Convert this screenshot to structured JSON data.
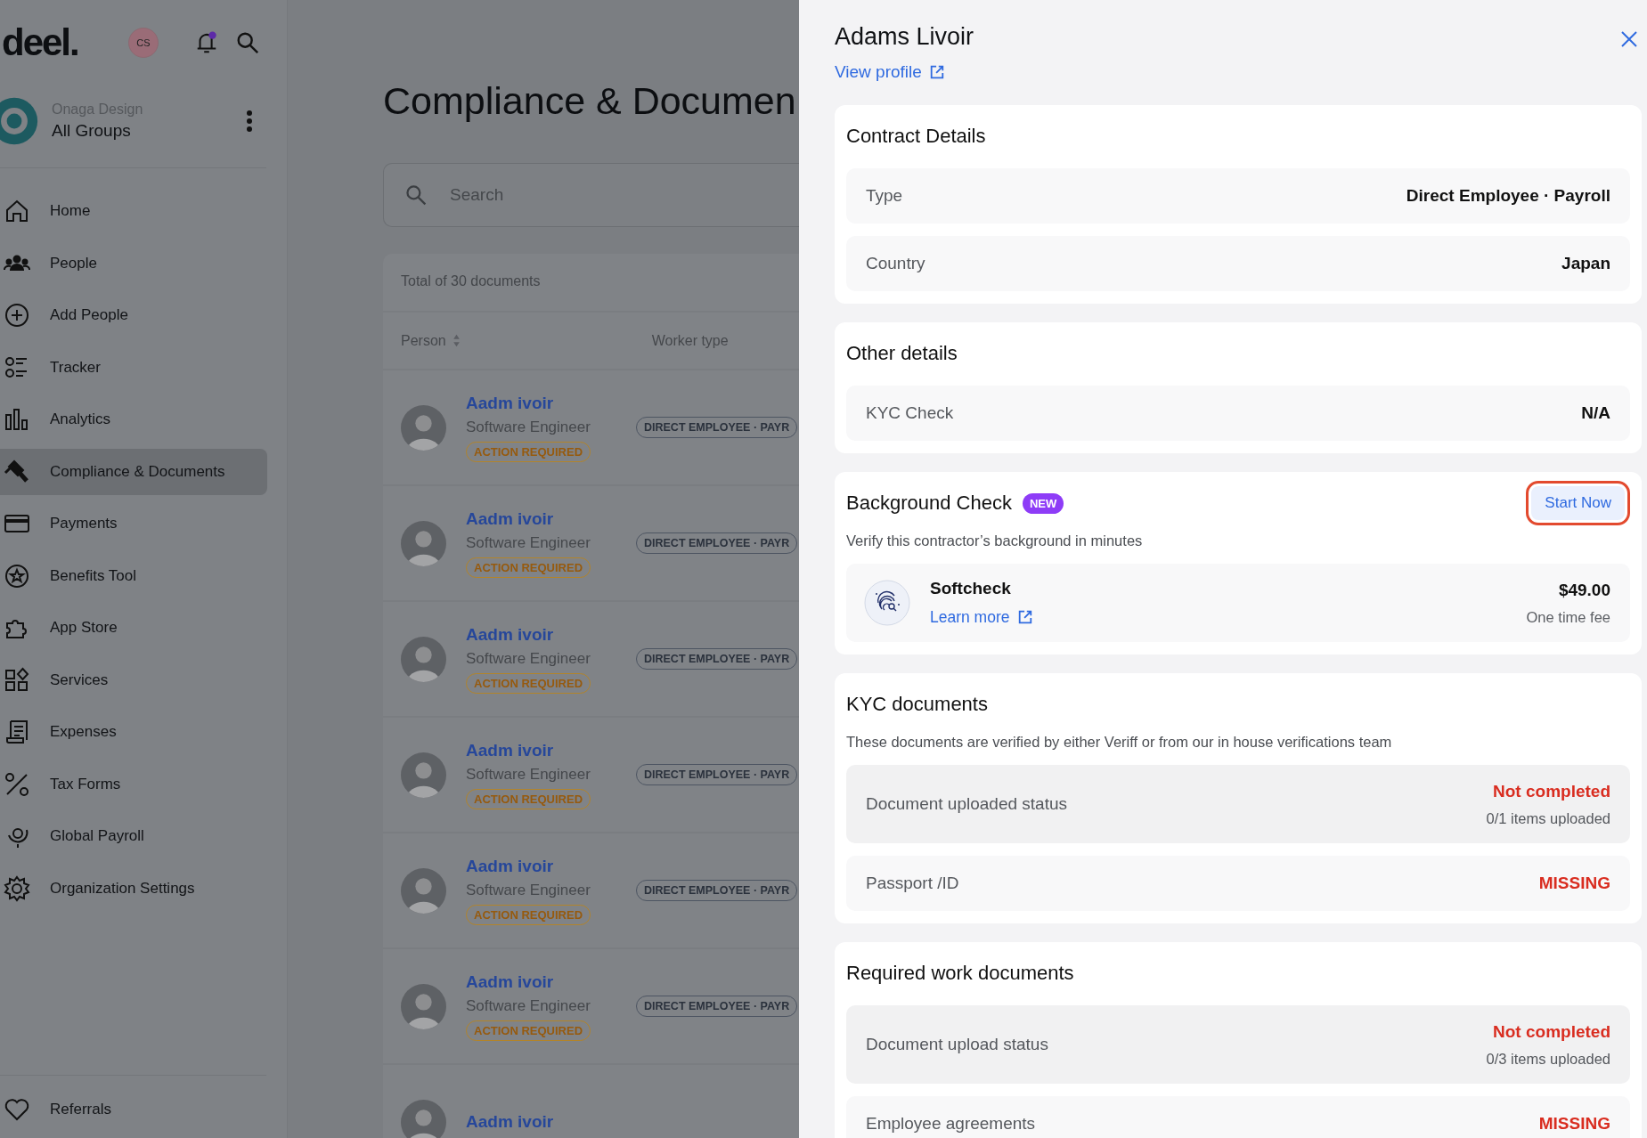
{
  "sidebar": {
    "logo": "deel.",
    "user_initials": "CS",
    "notification_unread": true,
    "org_name": "Onaga Design",
    "group": "All Groups",
    "items": [
      {
        "label": "Home",
        "selected": false
      },
      {
        "label": "People",
        "selected": false
      },
      {
        "label": "Add People",
        "selected": false
      },
      {
        "label": "Tracker",
        "selected": false
      },
      {
        "label": "Analytics",
        "selected": false
      },
      {
        "label": "Compliance & Documents",
        "selected": true
      },
      {
        "label": "Payments",
        "selected": false
      },
      {
        "label": "Benefits Tool",
        "selected": false
      },
      {
        "label": "App Store",
        "selected": false
      },
      {
        "label": "Services",
        "selected": false
      },
      {
        "label": "Expenses",
        "selected": false
      },
      {
        "label": "Tax Forms",
        "selected": false
      },
      {
        "label": "Global Payroll",
        "selected": false
      },
      {
        "label": "Organization Settings",
        "selected": false
      }
    ],
    "footer_items": [
      {
        "label": "Referrals",
        "selected": false
      }
    ]
  },
  "main": {
    "title": "Compliance & Documen",
    "search": {
      "placeholder": "Search"
    },
    "total": "Total of 30 documents",
    "columns": [
      "Person",
      "Worker type"
    ],
    "rows": [
      {
        "name": "Aadm ivoir",
        "role": "Software Engineer",
        "status": "ACTION REQUIRED",
        "worker_type": "DIRECT EMPLOYEE · PAYR"
      },
      {
        "name": "Aadm ivoir",
        "role": "Software Engineer",
        "status": "ACTION REQUIRED",
        "worker_type": "DIRECT EMPLOYEE · PAYR"
      },
      {
        "name": "Aadm ivoir",
        "role": "Software Engineer",
        "status": "ACTION REQUIRED",
        "worker_type": "DIRECT EMPLOYEE · PAYR"
      },
      {
        "name": "Aadm ivoir",
        "role": "Software Engineer",
        "status": "ACTION REQUIRED",
        "worker_type": "DIRECT EMPLOYEE · PAYR"
      },
      {
        "name": "Aadm ivoir",
        "role": "Software Engineer",
        "status": "ACTION REQUIRED",
        "worker_type": "DIRECT EMPLOYEE · PAYR"
      },
      {
        "name": "Aadm ivoir",
        "role": "Software Engineer",
        "status": "ACTION REQUIRED",
        "worker_type": "DIRECT EMPLOYEE · PAYR"
      },
      {
        "name": "Aadm ivoir"
      }
    ]
  },
  "panel": {
    "title": "Adams Livoir",
    "link": "View profile",
    "sections": [
      {
        "kind": "details",
        "title": "Contract Details",
        "rows": [
          {
            "label": "Type",
            "value": "Direct Employee · Payroll"
          },
          {
            "label": "Country",
            "value": "Japan"
          }
        ]
      },
      {
        "kind": "details",
        "title": "Other details",
        "rows": [
          {
            "label": "KYC Check",
            "value": "N/A"
          }
        ]
      },
      {
        "kind": "offer",
        "title": "Background Check",
        "badge": "NEW",
        "button": "Start Now",
        "description": "Verify this contractor’s background in minutes",
        "provider": {
          "name": "Softcheck",
          "link": "Learn more",
          "price": "$49.00",
          "price_note": "One time fee"
        }
      },
      {
        "kind": "documents",
        "title": "KYC documents",
        "description": "These documents are verified by either Veriff or from our in house verifications team",
        "rows": [
          {
            "kind": "status",
            "label": "Document uploaded status",
            "status": "Not completed",
            "count": "0/1 items uploaded"
          },
          {
            "kind": "item",
            "label": "Passport /ID",
            "status": "MISSING"
          }
        ]
      },
      {
        "kind": "documents",
        "title": "Required work documents",
        "rows": [
          {
            "kind": "status",
            "label": "Document upload status",
            "status": "Not completed",
            "count": "0/3 items uploaded"
          },
          {
            "kind": "item",
            "label": "Employee agreements",
            "status": "MISSING"
          }
        ]
      }
    ]
  }
}
